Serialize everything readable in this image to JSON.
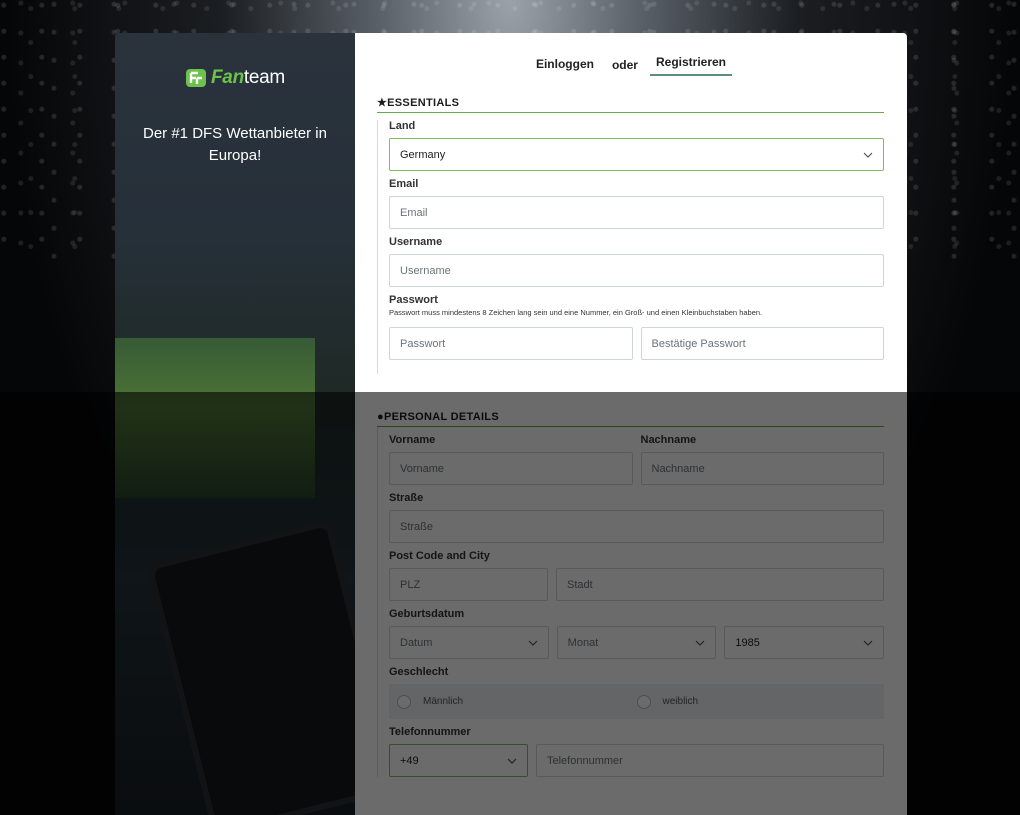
{
  "brand": {
    "logo_part1": "Fan",
    "logo_part2": "team",
    "tagline": "Der #1 DFS Wettanbieter in Europa!",
    "accent": "#6cc24a"
  },
  "tabs": {
    "login": "Einloggen",
    "or": "oder",
    "register": "Registrieren"
  },
  "essentials": {
    "title": "★ESSENTIALS",
    "country_label": "Land",
    "country_value": "Germany",
    "email_label": "Email",
    "email_placeholder": "Email",
    "username_label": "Username",
    "username_placeholder": "Username",
    "password_label": "Passwort",
    "password_hint": "Passwort muss mindestens 8 Zeichen lang sein und eine Nummer, ein Groß- und einen Kleinbuchstaben haben.",
    "password_placeholder": "Passwort",
    "confirm_placeholder": "Bestätige Passwort"
  },
  "personal": {
    "title": "PERSONAL DETAILS",
    "firstname_label": "Vorname",
    "firstname_placeholder": "Vorname",
    "lastname_label": "Nachname",
    "lastname_placeholder": "Nachname",
    "street_label": "Straße",
    "street_placeholder": "Straße",
    "postcode_label": "Post Code and City",
    "plz_placeholder": "PLZ",
    "city_placeholder": "Stadt",
    "birth_label": "Geburtsdatum",
    "day_placeholder": "Datum",
    "month_placeholder": "Monat",
    "year_value": "1985",
    "gender_label": "Geschlecht",
    "male": "Männlich",
    "female": "weiblich",
    "phone_label": "Telefonnummer",
    "phone_code": "+49",
    "phone_placeholder": "Telefonnummer"
  }
}
